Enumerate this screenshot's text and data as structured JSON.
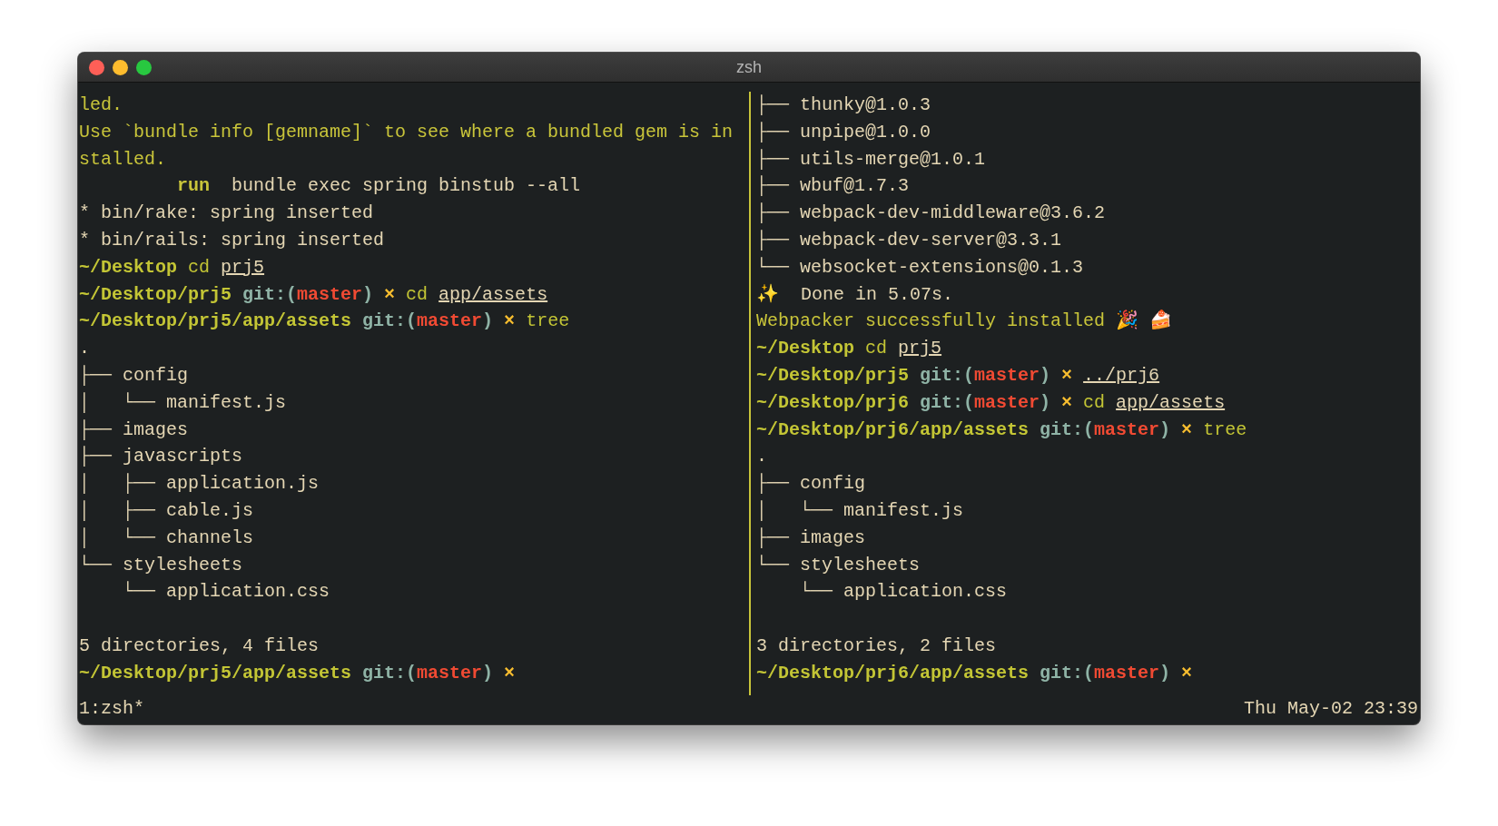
{
  "window": {
    "title": "zsh"
  },
  "panes": [
    {
      "lines": [
        {
          "segments": [
            {
              "kind": "notice",
              "text": "led."
            }
          ]
        },
        {
          "segments": [
            {
              "kind": "notice",
              "text": "Use `bundle info [gemname]` to see where a bundled gem is in"
            }
          ]
        },
        {
          "segments": [
            {
              "kind": "notice",
              "text": "stalled."
            }
          ]
        },
        {
          "segments": [
            {
              "kind": "run",
              "text": "         run"
            },
            {
              "kind": "text",
              "text": "  bundle exec spring binstub --all"
            }
          ]
        },
        {
          "segments": [
            {
              "kind": "text",
              "text": "* bin/rake: spring inserted"
            }
          ]
        },
        {
          "segments": [
            {
              "kind": "text",
              "text": "* bin/rails: spring inserted"
            }
          ]
        },
        {
          "segments": [
            {
              "kind": "path",
              "text": "~/Desktop"
            },
            {
              "kind": "cmd",
              "text": " cd "
            },
            {
              "kind": "arg",
              "text": "prj5"
            }
          ]
        },
        {
          "segments": [
            {
              "kind": "path",
              "text": "~/Desktop/prj5"
            },
            {
              "kind": "git",
              "text": " git:("
            },
            {
              "kind": "branch",
              "text": "master"
            },
            {
              "kind": "git",
              "text": ")"
            },
            {
              "kind": "dirty",
              "text": " ×"
            },
            {
              "kind": "cmd",
              "text": " cd "
            },
            {
              "kind": "arg",
              "text": "app/assets"
            }
          ]
        },
        {
          "segments": [
            {
              "kind": "path",
              "text": "~/Desktop/prj5/app/assets"
            },
            {
              "kind": "git",
              "text": " git:("
            },
            {
              "kind": "branch",
              "text": "master"
            },
            {
              "kind": "git",
              "text": ")"
            },
            {
              "kind": "dirty",
              "text": " ×"
            },
            {
              "kind": "cmd",
              "text": " tree"
            }
          ]
        },
        {
          "segments": [
            {
              "kind": "text",
              "text": "."
            }
          ]
        },
        {
          "segments": [
            {
              "kind": "text",
              "text": "├── config"
            }
          ]
        },
        {
          "segments": [
            {
              "kind": "text",
              "text": "│   └── manifest.js"
            }
          ]
        },
        {
          "segments": [
            {
              "kind": "text",
              "text": "├── images"
            }
          ]
        },
        {
          "segments": [
            {
              "kind": "text",
              "text": "├── javascripts"
            }
          ]
        },
        {
          "segments": [
            {
              "kind": "text",
              "text": "│   ├── application.js"
            }
          ]
        },
        {
          "segments": [
            {
              "kind": "text",
              "text": "│   ├── cable.js"
            }
          ]
        },
        {
          "segments": [
            {
              "kind": "text",
              "text": "│   └── channels"
            }
          ]
        },
        {
          "segments": [
            {
              "kind": "text",
              "text": "└── stylesheets"
            }
          ]
        },
        {
          "segments": [
            {
              "kind": "text",
              "text": "    └── application.css"
            }
          ]
        },
        {
          "blank_before": true,
          "segments": [
            {
              "kind": "text",
              "text": "5 directories, 4 files"
            }
          ]
        },
        {
          "segments": [
            {
              "kind": "path",
              "text": "~/Desktop/prj5/app/assets"
            },
            {
              "kind": "git",
              "text": " git:("
            },
            {
              "kind": "branch",
              "text": "master"
            },
            {
              "kind": "git",
              "text": ")"
            },
            {
              "kind": "dirty",
              "text": " ×"
            }
          ]
        }
      ]
    },
    {
      "lines": [
        {
          "segments": [
            {
              "kind": "text",
              "text": "├── thunky@1.0.3"
            }
          ]
        },
        {
          "segments": [
            {
              "kind": "text",
              "text": "├── unpipe@1.0.0"
            }
          ]
        },
        {
          "segments": [
            {
              "kind": "text",
              "text": "├── utils-merge@1.0.1"
            }
          ]
        },
        {
          "segments": [
            {
              "kind": "text",
              "text": "├── wbuf@1.7.3"
            }
          ]
        },
        {
          "segments": [
            {
              "kind": "text",
              "text": "├── webpack-dev-middleware@3.6.2"
            }
          ]
        },
        {
          "segments": [
            {
              "kind": "text",
              "text": "├── webpack-dev-server@3.3.1"
            }
          ]
        },
        {
          "segments": [
            {
              "kind": "text",
              "text": "└── websocket-extensions@0.1.3"
            }
          ]
        },
        {
          "segments": [
            {
              "kind": "text",
              "text": "✨  Done in 5.07s."
            }
          ]
        },
        {
          "segments": [
            {
              "kind": "notice",
              "text": "Webpacker successfully installed 🎉 🍰"
            }
          ]
        },
        {
          "segments": [
            {
              "kind": "path",
              "text": "~/Desktop"
            },
            {
              "kind": "cmd",
              "text": " cd "
            },
            {
              "kind": "arg",
              "text": "prj5"
            }
          ]
        },
        {
          "segments": [
            {
              "kind": "path",
              "text": "~/Desktop/prj5"
            },
            {
              "kind": "git",
              "text": " git:("
            },
            {
              "kind": "branch",
              "text": "master"
            },
            {
              "kind": "git",
              "text": ")"
            },
            {
              "kind": "dirty",
              "text": " × "
            },
            {
              "kind": "arg",
              "text": "../prj6"
            }
          ]
        },
        {
          "segments": [
            {
              "kind": "path",
              "text": "~/Desktop/prj6"
            },
            {
              "kind": "git",
              "text": " git:("
            },
            {
              "kind": "branch",
              "text": "master"
            },
            {
              "kind": "git",
              "text": ")"
            },
            {
              "kind": "dirty",
              "text": " ×"
            },
            {
              "kind": "cmd",
              "text": " cd "
            },
            {
              "kind": "arg",
              "text": "app/assets"
            }
          ]
        },
        {
          "segments": [
            {
              "kind": "path",
              "text": "~/Desktop/prj6/app/assets"
            },
            {
              "kind": "git",
              "text": " git:("
            },
            {
              "kind": "branch",
              "text": "master"
            },
            {
              "kind": "git",
              "text": ")"
            },
            {
              "kind": "dirty",
              "text": " ×"
            },
            {
              "kind": "cmd",
              "text": " tree"
            }
          ]
        },
        {
          "segments": [
            {
              "kind": "text",
              "text": "."
            }
          ]
        },
        {
          "segments": [
            {
              "kind": "text",
              "text": "├── config"
            }
          ]
        },
        {
          "segments": [
            {
              "kind": "text",
              "text": "│   └── manifest.js"
            }
          ]
        },
        {
          "segments": [
            {
              "kind": "text",
              "text": "├── images"
            }
          ]
        },
        {
          "segments": [
            {
              "kind": "text",
              "text": "└── stylesheets"
            }
          ]
        },
        {
          "segments": [
            {
              "kind": "text",
              "text": "    └── application.css"
            }
          ]
        },
        {
          "blank_before": true,
          "segments": [
            {
              "kind": "text",
              "text": "3 directories, 2 files"
            }
          ]
        },
        {
          "segments": [
            {
              "kind": "path",
              "text": "~/Desktop/prj6/app/assets"
            },
            {
              "kind": "git",
              "text": " git:("
            },
            {
              "kind": "branch",
              "text": "master"
            },
            {
              "kind": "git",
              "text": ")"
            },
            {
              "kind": "dirty",
              "text": " ×"
            }
          ]
        }
      ]
    }
  ],
  "status_bar": {
    "window_list": "1:zsh*",
    "clock": "Thu May-02 23:39"
  }
}
